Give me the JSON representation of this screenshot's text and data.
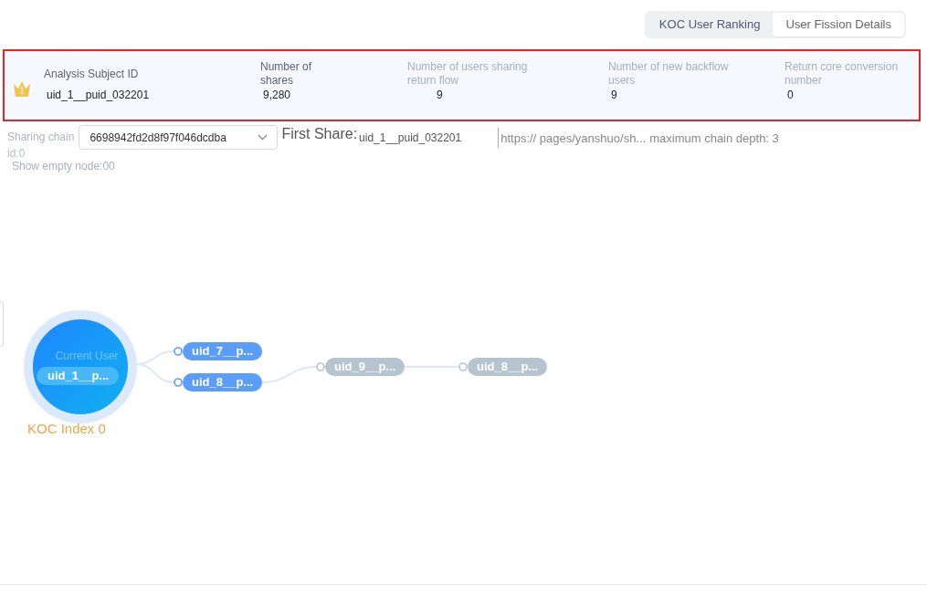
{
  "tabs": [
    {
      "label": "KOC User Ranking",
      "selected": false
    },
    {
      "label": "User Fission Details",
      "selected": true
    }
  ],
  "summary": {
    "rank": "1",
    "metrics": [
      {
        "label": "Analysis Subject ID",
        "value": "uid_1__puid_032201",
        "dimmed": false
      },
      {
        "label": "Number of shares",
        "value": "9,280",
        "dimmed": false
      },
      {
        "label": "Number of users sharing return flow",
        "value": "9",
        "dimmed": true
      },
      {
        "label": "Number of new backflow users",
        "value": "9",
        "dimmed": true
      },
      {
        "label": "Return core conversion number",
        "value": "0",
        "dimmed": true
      }
    ]
  },
  "filters": {
    "chain_label": "Sharing chain",
    "chain_id": "id:0",
    "chain_select": {
      "value": "6698942fd2d8f97f046dcdba"
    },
    "first_share": {
      "label": "First Share:",
      "value": "uid_1__puid_032201"
    },
    "share_url": "https:// pages/yanshuo/sh...",
    "max_depth": "maximum chain depth: 3",
    "show_empty_node": {
      "label": "Show empty node:",
      "value": "00"
    }
  },
  "graph": {
    "root": {
      "title": "Current User",
      "label": "uid_1__p...",
      "caption": "KOC Index 0",
      "children": [
        {
          "label": "uid_7__p...",
          "color": "#5b9dfb"
        },
        {
          "label": "uid_8__p...",
          "color": "#5b9dfb",
          "children": [
            {
              "label": "uid_9__p...",
              "color": "#b5c4cf",
              "children": [
                {
                  "label": "uid_8__p...",
                  "color": "#b5c4cf"
                }
              ]
            }
          ]
        }
      ]
    }
  }
}
